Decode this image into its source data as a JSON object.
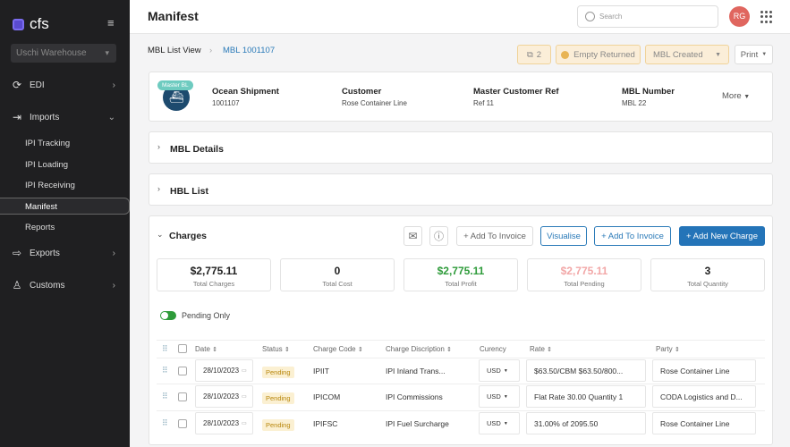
{
  "sidebar": {
    "logo": "cfs",
    "warehouse": "Uschi Warehouse",
    "items": [
      {
        "label": "EDI",
        "icon": "sync-icon"
      },
      {
        "label": "Imports",
        "icon": "import-icon"
      },
      {
        "label": "Exports",
        "icon": "export-icon"
      },
      {
        "label": "Customs",
        "icon": "customs-officer-icon"
      }
    ],
    "imports_sub": [
      "IPI Tracking",
      "IPI Loading",
      "IPI Receiving",
      "Manifest",
      "Reports"
    ],
    "active": "Manifest"
  },
  "header": {
    "title": "Manifest",
    "search_placeholder": "Search",
    "avatar": "RG"
  },
  "breadcrumb": {
    "root": "MBL List View",
    "current": "MBL 1001107"
  },
  "actions": {
    "copies": "2",
    "status": "Empty Returned",
    "stage": "MBL Created",
    "print": "Print"
  },
  "summary": {
    "badge": "Master BL",
    "fields": [
      {
        "label": "Ocean Shipment",
        "value": "1001107"
      },
      {
        "label": "Customer",
        "value": "Rose Container Line"
      },
      {
        "label": "Master Customer Ref",
        "value": "Ref 11"
      },
      {
        "label": "MBL Number",
        "value": "MBL 22"
      }
    ],
    "more": "More"
  },
  "sections": {
    "mbl": "MBL Details",
    "hbl": "HBL List",
    "charges": "Charges"
  },
  "charges": {
    "add_invoice_1": "+ Add To Invoice",
    "visualise": "Visualise",
    "add_invoice_2": "+ Add To Invoice",
    "add_new": "+ Add New Charge",
    "stats": [
      {
        "value": "$2,775.11",
        "label": "Total Charges",
        "color": "#222222"
      },
      {
        "value": "0",
        "label": "Total Cost",
        "color": "#222222"
      },
      {
        "value": "$2,775.11",
        "label": "Total Profit",
        "color": "#2e9b3a"
      },
      {
        "value": "$2,775.11",
        "label": "Total Pending",
        "color": "#f2a7a7"
      },
      {
        "value": "3",
        "label": "Total Quantity",
        "color": "#222222"
      }
    ],
    "pending_only": "Pending Only",
    "pending_only_on": true,
    "columns": [
      "Date",
      "Status",
      "Charge Code",
      "Charge Discription",
      "Curency",
      "Rate",
      "Party"
    ],
    "rows": [
      {
        "date": "28/10/2023",
        "status": "Pending",
        "code": "IPIIT",
        "desc": "IPI Inland Trans...",
        "currency": "USD",
        "rate": "$63.50/CBM $63.50/800...",
        "party": "Rose Container Line"
      },
      {
        "date": "28/10/2023",
        "status": "Pending",
        "code": "IPICOM",
        "desc": "IPI Commissions",
        "currency": "USD",
        "rate": "Flat Rate 30.00 Quantity 1",
        "party": "CODA Logistics and D..."
      },
      {
        "date": "28/10/2023",
        "status": "Pending",
        "code": "IPIFSC",
        "desc": "IPI Fuel Surcharge",
        "currency": "USD",
        "rate": "31.00% of 2095.50",
        "party": "Rose Container Line"
      }
    ]
  }
}
